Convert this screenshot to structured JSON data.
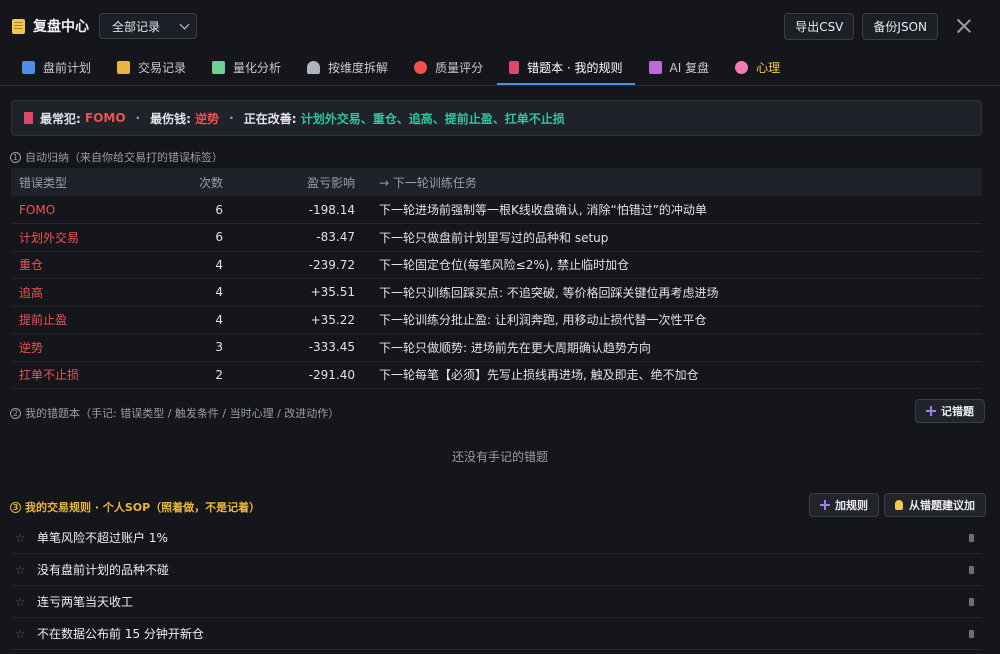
{
  "header": {
    "title": "复盘中心",
    "filter_value": "全部记录",
    "export_csv": "导出CSV",
    "backup_json": "备份JSON"
  },
  "tabs": [
    {
      "label": "盘前计划",
      "icon": "calendar-icon",
      "color": "#4a8fe7"
    },
    {
      "label": "交易记录",
      "icon": "notepad-icon",
      "color": "#e8b63b"
    },
    {
      "label": "量化分析",
      "icon": "bar-chart-icon",
      "color": "#6fcf97"
    },
    {
      "label": "按维度拆解",
      "icon": "microscope-icon",
      "color": "#b0b3bd"
    },
    {
      "label": "质量评分",
      "icon": "target-icon",
      "color": "#f05252"
    },
    {
      "label": "错题本 · 我的规则",
      "icon": "red-book-icon",
      "color": "#e0456a",
      "active": true
    },
    {
      "label": "AI 复盘",
      "icon": "robot-icon",
      "color": "#bb6bd9"
    },
    {
      "label": "心理",
      "icon": "brain-icon",
      "color": "#f27ab5",
      "accent": "#f2c94c"
    }
  ],
  "banner": {
    "most_common_label": "最常犯:",
    "most_common_value": "FOMO",
    "costliest_label": "最伤钱:",
    "costliest_value": "逆势",
    "improving_label": "正在改善:",
    "improving_value": "计划外交易、重仓、追高、提前止盈、扛单不止损"
  },
  "section1": {
    "num": "1",
    "title": "自动归纳（来自你给交易打的错误标签）"
  },
  "table": {
    "headers": [
      "错误类型",
      "次数",
      "盈亏影响",
      "→ 下一轮训练任务"
    ],
    "rows": [
      {
        "type": "FOMO",
        "count": "6",
        "pnl": "-198.14",
        "task": "下一轮进场前强制等一根K线收盘确认, 消除“怕错过”的冲动单"
      },
      {
        "type": "计划外交易",
        "count": "6",
        "pnl": "-83.47",
        "task": "下一轮只做盘前计划里写过的品种和 setup"
      },
      {
        "type": "重仓",
        "count": "4",
        "pnl": "-239.72",
        "task": "下一轮固定仓位(每笔风险≤2%), 禁止临时加仓"
      },
      {
        "type": "追高",
        "count": "4",
        "pnl": "+35.51",
        "task": "下一轮只训练回踩买点: 不追突破, 等价格回踩关键位再考虑进场"
      },
      {
        "type": "提前止盈",
        "count": "4",
        "pnl": "+35.22",
        "task": "下一轮训练分批止盈: 让利润奔跑, 用移动止损代替一次性平仓"
      },
      {
        "type": "逆势",
        "count": "3",
        "pnl": "-333.45",
        "task": "下一轮只做顺势: 进场前先在更大周期确认趋势方向"
      },
      {
        "type": "扛单不止损",
        "count": "2",
        "pnl": "-291.40",
        "task": "下一轮每笔【必须】先写止损线再进场, 触及即走、绝不加仓"
      }
    ]
  },
  "section2": {
    "num": "2",
    "title": "我的错题本（手记: 错误类型 / 触发条件 / 当时心理 / 改进动作）",
    "add_button": "记错题",
    "empty_text": "还没有手记的错题"
  },
  "section3": {
    "num": "3",
    "title": "我的交易规则 · 个人SOP（照着做，不是记着）",
    "add_rule_button": "加规则",
    "suggest_button": "从错题建议加",
    "rules": [
      "单笔风险不超过账户 1%",
      "没有盘前计划的品种不碰",
      "连亏两笔当天收工",
      "不在数据公布前 15 分钟开新仓"
    ]
  }
}
